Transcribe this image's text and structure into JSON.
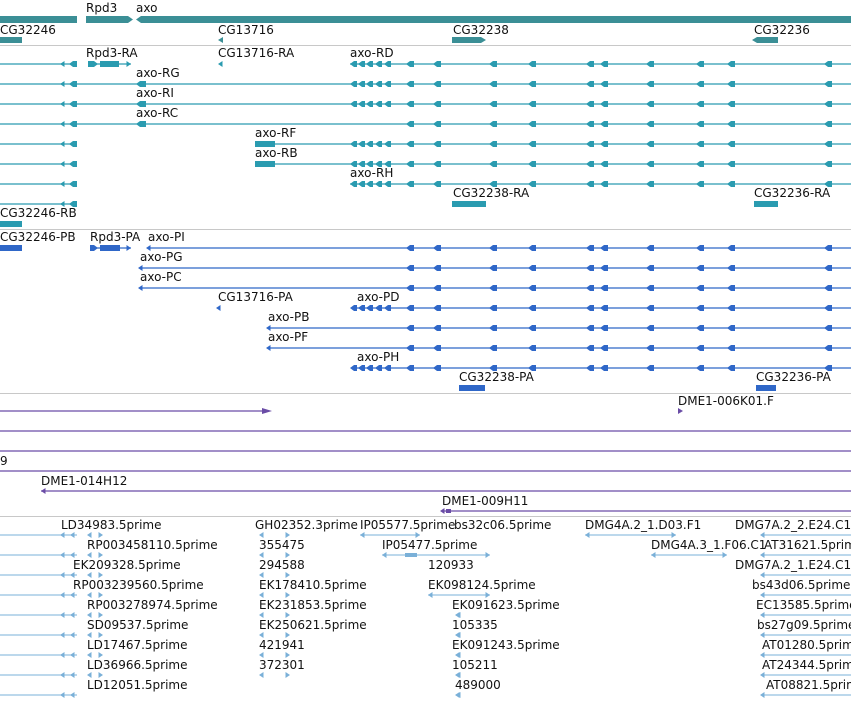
{
  "colors": {
    "gene": "#3b8f96",
    "transcript_rna": "#2a9bb0",
    "transcript_protein": "#2f67c8",
    "clone": "#6a4ca6",
    "est": "#7ab0d8",
    "separator": "#c8c8c8",
    "text": "#111111"
  },
  "genes_track": {
    "labels": [
      "Rpd3",
      "axo",
      "CG32246",
      "CG13716",
      "CG32238",
      "CG32236"
    ]
  },
  "mrna_track": {
    "labels": [
      "Rpd3-RA",
      "axo-RD",
      "CG13716-RA",
      "axo-RG",
      "axo-RI",
      "axo-RC",
      "axo-RF",
      "axo-RB",
      "axo-RH",
      "CG32238-RA",
      "CG32236-RA",
      "CG32246-RB"
    ]
  },
  "protein_track": {
    "labels": [
      "CG32246-PB",
      "Rpd3-PA",
      "axo-PI",
      "axo-PG",
      "axo-PC",
      "CG13716-PA",
      "axo-PD",
      "axo-PB",
      "axo-PF",
      "axo-PH",
      "CG32238-PA",
      "CG32236-PA"
    ]
  },
  "clone_track": {
    "labels": [
      "DME1-006K01.F",
      "9",
      "DME1-014H12",
      "DME1-009H11"
    ]
  },
  "est_track": {
    "labels": [
      "LD34983.5prime",
      "GH02352.3prime",
      "IP05577.5prime",
      "bs32c06.5prime",
      "DMG4A.2_1.D03.F1",
      "DMG7A.2_2.E24.C1",
      "RP003458110.5prime",
      "355475",
      "IP05477.5prime",
      "DMG4A.3_1.F06.C1",
      "AT31621.5prime",
      "EK209328.5prime",
      "294588",
      "120933",
      "DMG7A.2_1.E24.C1",
      "RP003239560.5prime",
      "EK178410.5prime",
      "EK098124.5prime",
      "bs43d06.5prime",
      "RP003278974.5prime",
      "EK231853.5prime",
      "EK091623.5prime",
      "EC13585.5prime",
      "SD09537.5prime",
      "EK250621.5prime",
      "105335",
      "bs27g09.5prime",
      "LD17467.5prime",
      "421941",
      "EK091243.5prime",
      "AT01280.5prime",
      "LD36966.5prime",
      "372301",
      "105211",
      "AT24344.5prime",
      "LD12051.5prime",
      "489000",
      "AT08821.5prime"
    ]
  }
}
